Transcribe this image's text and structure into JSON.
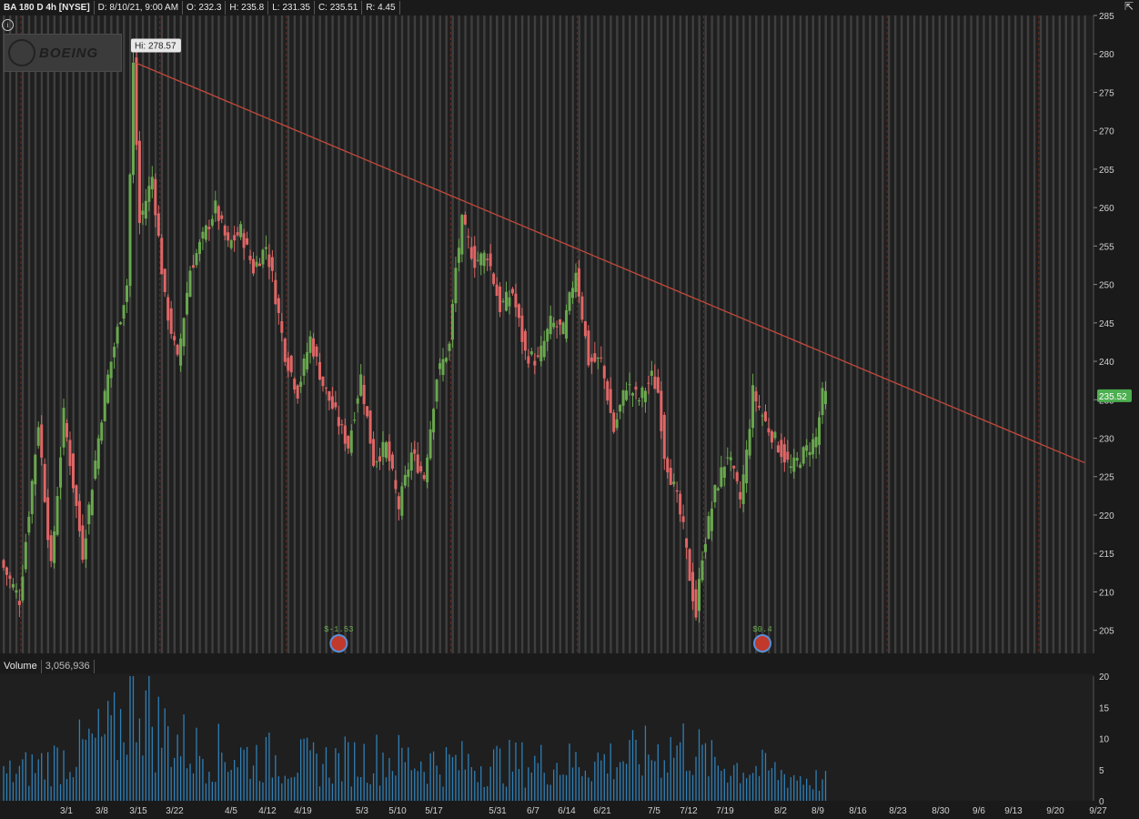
{
  "header": {
    "symbol": "BA 180 D 4h [NYSE]",
    "date": "D: 8/10/21, 9:00 AM",
    "open": "O: 232.3",
    "high": "H: 235.8",
    "low": "L: 231.35",
    "close": "C: 235.51",
    "range": "R: 4.45"
  },
  "logo_text": "BOEING",
  "volume_header": {
    "label": "Volume",
    "value": "3,056,936"
  },
  "chart_data": {
    "type": "candlestick",
    "y_axis": {
      "min": 202,
      "max": 285,
      "ticks": [
        205,
        210,
        215,
        220,
        225,
        230,
        235,
        240,
        245,
        250,
        255,
        260,
        265,
        270,
        275,
        280,
        285
      ]
    },
    "x_ticks": [
      "3/1",
      "3/8",
      "3/15",
      "3/22",
      "4/5",
      "4/12",
      "4/19",
      "5/3",
      "5/10",
      "5/17",
      "5/31",
      "6/7",
      "6/14",
      "6/21",
      "7/5",
      "7/12",
      "7/19",
      "8/2",
      "8/9",
      "8/16",
      "8/23",
      "8/30",
      "9/6",
      "9/13",
      "9/20",
      "9/27"
    ],
    "price_path": [
      [
        0,
        214
      ],
      [
        3,
        209
      ],
      [
        6,
        232
      ],
      [
        8,
        213
      ],
      [
        10,
        233
      ],
      [
        13,
        215
      ],
      [
        16,
        233
      ],
      [
        17,
        238
      ],
      [
        20,
        250
      ],
      [
        21,
        278.5
      ],
      [
        22,
        258
      ],
      [
        24,
        264
      ],
      [
        26,
        248
      ],
      [
        28,
        240
      ],
      [
        30,
        252
      ],
      [
        32,
        256
      ],
      [
        34,
        260
      ],
      [
        36,
        255
      ],
      [
        38,
        257
      ],
      [
        40,
        252
      ],
      [
        42,
        255
      ],
      [
        43,
        251
      ],
      [
        45,
        241
      ],
      [
        47,
        236
      ],
      [
        49,
        243
      ],
      [
        51,
        237
      ],
      [
        53,
        233
      ],
      [
        55,
        229
      ],
      [
        57,
        238
      ],
      [
        59,
        227
      ],
      [
        61,
        229
      ],
      [
        63,
        221
      ],
      [
        65,
        228
      ],
      [
        67,
        225
      ],
      [
        69,
        238
      ],
      [
        71,
        242
      ],
      [
        72,
        252
      ],
      [
        73,
        258
      ],
      [
        75,
        253
      ],
      [
        77,
        254
      ],
      [
        79,
        247
      ],
      [
        81,
        249
      ],
      [
        83,
        241
      ],
      [
        85,
        240
      ],
      [
        87,
        245
      ],
      [
        89,
        244
      ],
      [
        91,
        252
      ],
      [
        93,
        240
      ],
      [
        95,
        240
      ],
      [
        97,
        231
      ],
      [
        99,
        237
      ],
      [
        101,
        235
      ],
      [
        103,
        238
      ],
      [
        104,
        236
      ],
      [
        105,
        228
      ],
      [
        107,
        222
      ],
      [
        108,
        218
      ],
      [
        109,
        212
      ],
      [
        110,
        207
      ],
      [
        111,
        215
      ],
      [
        113,
        223
      ],
      [
        115,
        228
      ],
      [
        117,
        222
      ],
      [
        118,
        228
      ],
      [
        119,
        236
      ],
      [
        121,
        232
      ],
      [
        123,
        229
      ],
      [
        125,
        226
      ],
      [
        127,
        228
      ],
      [
        129,
        230
      ],
      [
        130,
        235.5
      ]
    ],
    "volume": {
      "axis": {
        "min": 0,
        "max": 20,
        "ticks": [
          0,
          5,
          10,
          15,
          20
        ]
      },
      "last_value": 3056936,
      "profile": [
        [
          0,
          4
        ],
        [
          10,
          7
        ],
        [
          18,
          11
        ],
        [
          21,
          19
        ],
        [
          24,
          12
        ],
        [
          30,
          8
        ],
        [
          40,
          7
        ],
        [
          50,
          6
        ],
        [
          60,
          7
        ],
        [
          70,
          6
        ],
        [
          80,
          6
        ],
        [
          90,
          6
        ],
        [
          100,
          7
        ],
        [
          108,
          9
        ],
        [
          112,
          6
        ],
        [
          120,
          5
        ],
        [
          130,
          3
        ]
      ],
      "color": "#2f7fb6"
    },
    "trendline": {
      "from": {
        "x_bar": 21,
        "y": 278.8
      },
      "to": {
        "x_bar": 171,
        "y": 226.8
      },
      "color": "#c2483a"
    },
    "hi_label": "Hi: 278.57",
    "last_price_label": "235.52",
    "dividends": [
      {
        "label": "$-1.53",
        "x_bar": 53
      },
      {
        "label": "$0.4",
        "x_bar": 120
      }
    ],
    "month_dividers": [
      "3/1",
      "4/1",
      "5/3",
      "6/1",
      "7/1",
      "8/2",
      "9/1",
      "10/1"
    ],
    "colors": {
      "up": "#6aa84f",
      "down": "#e06666",
      "background": "#1f1f1f",
      "stripe": "#5a5a5a",
      "last_price_bg": "#4caf50"
    }
  }
}
